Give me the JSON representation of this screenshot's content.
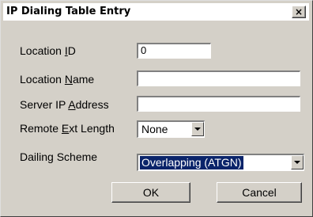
{
  "dialog": {
    "title": "IP Dialing Table Entry",
    "close_label": "×"
  },
  "fields": {
    "location_id": {
      "label_pre": "Location ",
      "label_key": "I",
      "label_post": "D",
      "value": "0"
    },
    "location_name": {
      "label_pre": "Location ",
      "label_key": "N",
      "label_post": "ame",
      "value": ""
    },
    "server_ip": {
      "label_pre": "Server IP ",
      "label_key": "A",
      "label_post": "ddress",
      "value": ""
    },
    "remote_ext_length": {
      "label_pre": "Remote ",
      "label_key": "E",
      "label_post": "xt Length",
      "value": "None"
    },
    "dialing_scheme": {
      "label": "Dailing Scheme",
      "value": "Overlapping (ATGN)"
    }
  },
  "buttons": {
    "ok": "OK",
    "cancel": "Cancel"
  }
}
